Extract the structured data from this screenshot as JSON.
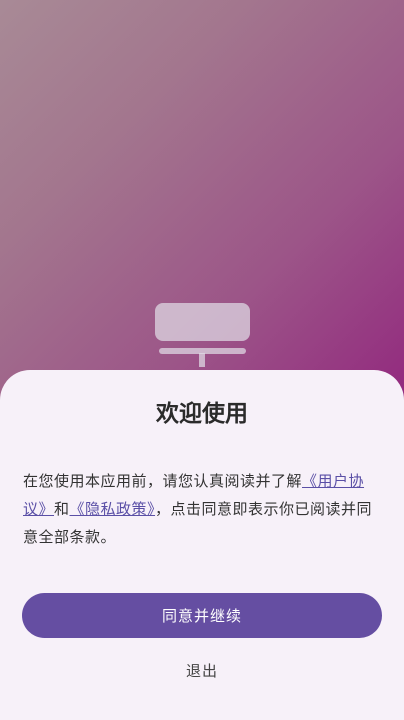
{
  "dialog": {
    "title": "欢迎使用",
    "message_prefix": "在您使用本应用前，请您认真阅读并了解",
    "user_agreement_link": "《用户协议》",
    "conjunction": "和",
    "privacy_policy_link": "《隐私政策》",
    "message_suffix": "，点击同意即表示你已阅读并同意全部条款。",
    "agree_button_label": "同意并继续",
    "exit_button_label": "退出"
  },
  "colors": {
    "accent": "#654ea2",
    "link": "#5a4fa6",
    "sheet_background": "#f7f1f9",
    "backdrop_start": "#a88a96",
    "backdrop_end": "#8a1775"
  },
  "icons": {
    "app_logo": "monitor-icon"
  }
}
